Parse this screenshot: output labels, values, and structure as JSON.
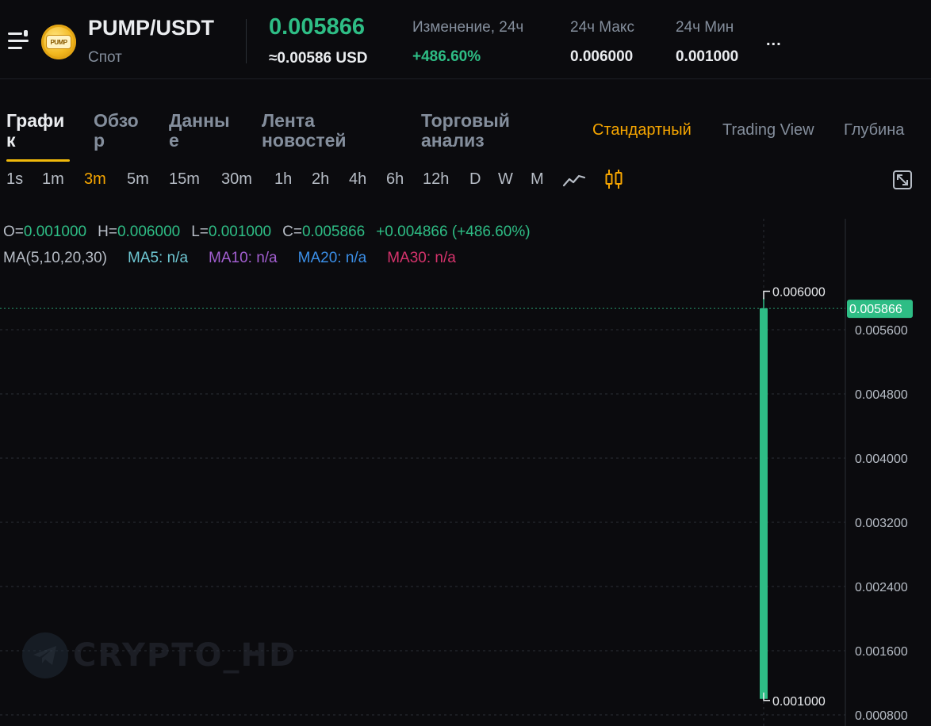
{
  "header": {
    "pair": "PUMP/USDT",
    "market_type": "Спот",
    "coin_logo_text": "PUMP",
    "last_price": "0.005866",
    "usd_price": "≈0.00586 USD",
    "stats": [
      {
        "label": "Изменение, 24ч",
        "value": "+486.60%",
        "color": "#2ebd85"
      },
      {
        "label": "24ч Макс",
        "value": "0.006000"
      },
      {
        "label": "24ч Мин",
        "value": "0.001000"
      }
    ],
    "more": "..."
  },
  "tabs": [
    {
      "label": "Графи\nк",
      "active": true
    },
    {
      "label": "Обзо\nр"
    },
    {
      "label": "Данны\nе"
    },
    {
      "label": "Лента\nновостей"
    },
    {
      "label": "Торговый\nанализ"
    }
  ],
  "view_modes": [
    {
      "label": "Стандартный",
      "active": true
    },
    {
      "label": "Trading View"
    },
    {
      "label": "Глубина"
    }
  ],
  "intervals": [
    {
      "label": "1s"
    },
    {
      "label": "1m"
    },
    {
      "label": "3m",
      "active": true
    },
    {
      "label": "5m"
    },
    {
      "label": "15m"
    },
    {
      "label": "30m"
    },
    {
      "label": "1h"
    },
    {
      "label": "2h"
    },
    {
      "label": "4h"
    },
    {
      "label": "6h"
    },
    {
      "label": "12h"
    },
    {
      "label": "D"
    },
    {
      "label": "W"
    },
    {
      "label": "M"
    }
  ],
  "icons": {
    "line_chart": "line-chart-icon",
    "candle_chart": "candlestick-icon",
    "fullscreen": "fullscreen-icon",
    "menu": "menu-icon"
  },
  "ohlc": {
    "o_label": "O=",
    "o": "0.001000",
    "h_label": "H=",
    "h": "0.006000",
    "l_label": "L=",
    "l": "0.001000",
    "c_label": "C=",
    "c": "0.005866",
    "change": "+0.004866 (+486.60%)"
  },
  "ma": {
    "label": "MA(5,10,20,30)",
    "items": [
      {
        "text": "MA5: n/a",
        "color": "#6fc8d4"
      },
      {
        "text": "MA10: n/a",
        "color": "#a35fd1"
      },
      {
        "text": "MA20: n/a",
        "color": "#3b8fe8"
      },
      {
        "text": "MA30: n/a",
        "color": "#d6336c"
      }
    ]
  },
  "chart_data": {
    "type": "candlestick",
    "candles": [
      {
        "open": 0.001,
        "high": 0.006,
        "low": 0.001,
        "close": 0.005866
      }
    ],
    "y_ticks": [
      "0.005600",
      "0.004800",
      "0.004000",
      "0.003200",
      "0.002400",
      "0.001600",
      "0.000800"
    ],
    "y_tick_values": [
      0.0056,
      0.0048,
      0.004,
      0.0032,
      0.0024,
      0.0016,
      0.0008
    ],
    "high_label": "0.006000",
    "low_label": "0.001000",
    "last_price_label": "0.005866",
    "last_price": 0.005866,
    "colors": {
      "up": "#2ebd85",
      "grid": "#2b2f36",
      "axis_text": "#b7bdc6"
    }
  },
  "watermark": "CRYPTO_HD"
}
